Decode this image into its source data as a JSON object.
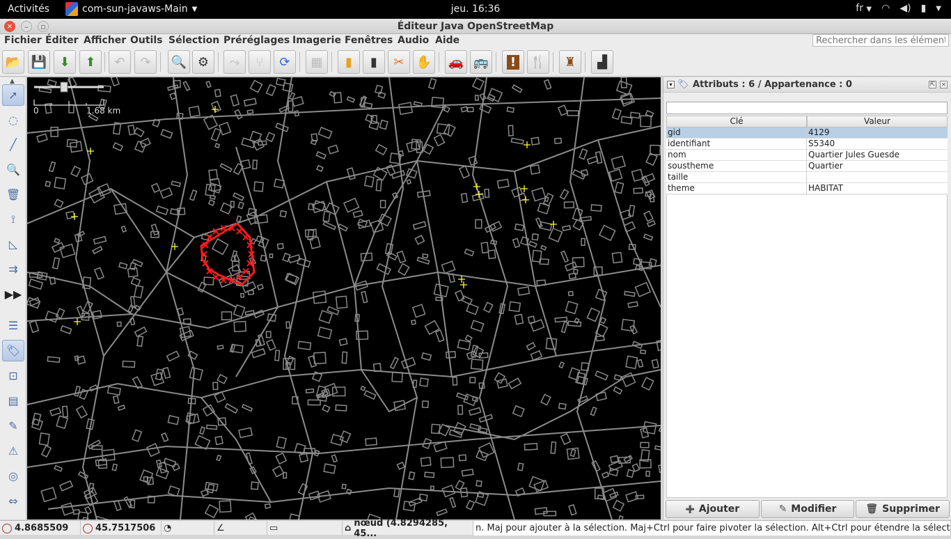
{
  "system_bar": {
    "activities": "Activités",
    "app_name": "com-sun-javaws-Main",
    "clock": "jeu. 16:36",
    "lang": "fr"
  },
  "window": {
    "title": "Éditeur Java OpenStreetMap"
  },
  "menu": {
    "items": [
      "Fichier",
      "Éditer",
      "Afficher",
      "Outils",
      "Sélection",
      "Préréglages",
      "Imagerie",
      "Fenêtres",
      "Audio",
      "Aide"
    ],
    "search_placeholder": "Rechercher dans les éléments"
  },
  "toolbar": {
    "buttons": [
      "open-icon",
      "save-icon",
      "download-icon",
      "upload-icon",
      "undo-icon",
      "redo-icon",
      "zoom-icon",
      "preferences-icon",
      "simplify-icon",
      "split-icon",
      "refresh-icon",
      "blank-icon",
      "road-icon",
      "railway-icon",
      "tools-icon",
      "hand-icon",
      "car-icon",
      "bus-icon",
      "warning-icon",
      "restaurant-icon",
      "castle-icon",
      "factory-icon"
    ]
  },
  "map": {
    "scale_start": "0",
    "scale_end": "1.68 km"
  },
  "properties_panel": {
    "title": "Attributs : 6 / Appartenance : 0",
    "col_key": "Clé",
    "col_value": "Valeur",
    "rows": [
      {
        "key": "gid",
        "value": "4129"
      },
      {
        "key": "identifiant",
        "value": "S5340"
      },
      {
        "key": "nom",
        "value": "Quartier Jules Guesde"
      },
      {
        "key": "soustheme",
        "value": "Quartier"
      },
      {
        "key": "taille",
        "value": ""
      },
      {
        "key": "theme",
        "value": "HABITAT"
      }
    ],
    "add_label": "Ajouter",
    "edit_label": "Modifier",
    "delete_label": "Supprimer"
  },
  "statusbar": {
    "lon": "4.8685509",
    "lat": "45.7517506",
    "node": "nœud (4.8294285, 45...",
    "help": "n. Maj pour ajouter à la sélection. Maj+Ctrl pour faire pivoter la sélection. Alt+Ctrl pour étendre la sélection."
  }
}
